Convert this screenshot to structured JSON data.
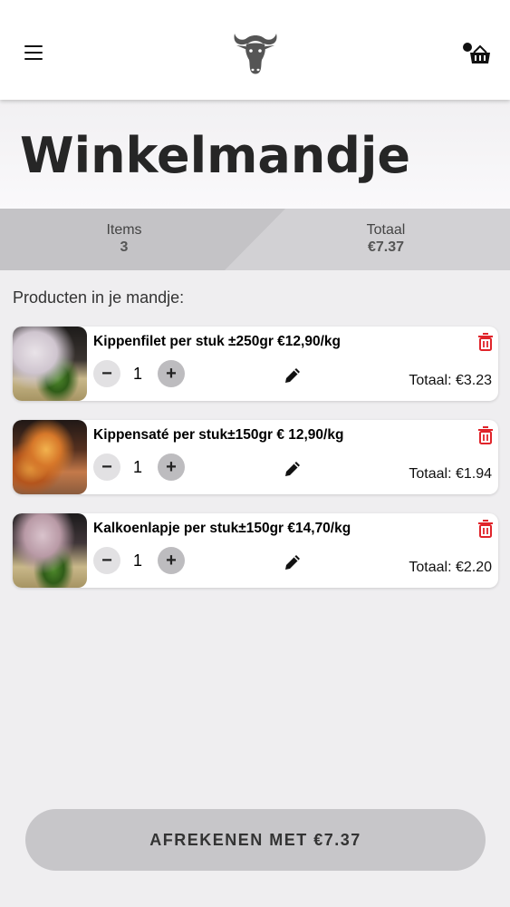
{
  "header": {
    "menu_icon": "hamburger-menu-icon",
    "logo_icon": "cow-head-logo",
    "cart_icon": "shopping-basket-icon"
  },
  "page": {
    "title": "Winkelmandje"
  },
  "summary": {
    "items_label": "Items",
    "items_value": "3",
    "total_label": "Totaal",
    "total_value": "€7.37"
  },
  "section_label": "Producten in je mandje:",
  "products": [
    {
      "name": "Kippenfilet per stuk ±250gr €12,90/kg",
      "quantity": "1",
      "total": "Totaal: €3.23"
    },
    {
      "name": "Kippensaté per stuk±150gr € 12,90/kg",
      "quantity": "1",
      "total": "Totaal: €1.94"
    },
    {
      "name": "Kalkoenlapje per stuk±150gr €14,70/kg",
      "quantity": "1",
      "total": "Totaal: €2.20"
    }
  ],
  "controls": {
    "minus": "−",
    "plus": "+"
  },
  "checkout_label": "AFREKENEN MET €7.37",
  "colors": {
    "delete": "#e0242a",
    "summary_dark": "#c4c3c6",
    "summary_light": "#d2d1d4",
    "checkout_bg": "#c7c6c9"
  }
}
